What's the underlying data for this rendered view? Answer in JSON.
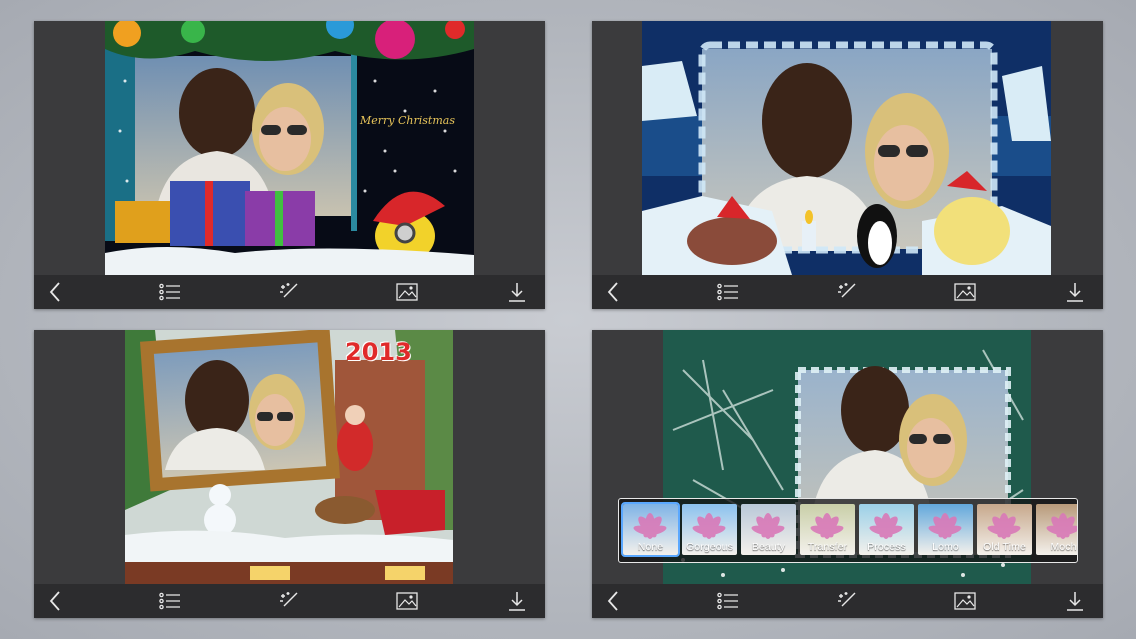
{
  "panels": [
    {
      "id": "christmas-minion-frame",
      "caption": "Merry Christmas",
      "year": ""
    },
    {
      "id": "snowflake-animals-frame",
      "caption": "",
      "year": ""
    },
    {
      "id": "wooden-frame-2013",
      "caption": "",
      "year": "2013"
    },
    {
      "id": "pine-snowflake-frame",
      "caption": "",
      "year": ""
    }
  ],
  "toolbar": {
    "icons": [
      "chevron-left-icon",
      "list-icon",
      "magic-wand-icon",
      "image-icon",
      "download-icon"
    ]
  },
  "filters": [
    {
      "label": "None",
      "tint": "#7fb3e6",
      "selected": true
    },
    {
      "label": "Gorgeous",
      "tint": "#8cc2ee"
    },
    {
      "label": "Beauty",
      "tint": "#b9c8d8"
    },
    {
      "label": "Transfer",
      "tint": "#c9cfa8"
    },
    {
      "label": "Process",
      "tint": "#9bd0e8"
    },
    {
      "label": "Lomo",
      "tint": "#63a8dc"
    },
    {
      "label": "Old Time",
      "tint": "#c7a88c"
    },
    {
      "label": "Moch",
      "tint": "#b89a7a"
    }
  ],
  "colors": {
    "panel_bg": "#3b3b3d",
    "toolbar_bg": "#2c2c2e",
    "icon": "#e8e8e8"
  }
}
